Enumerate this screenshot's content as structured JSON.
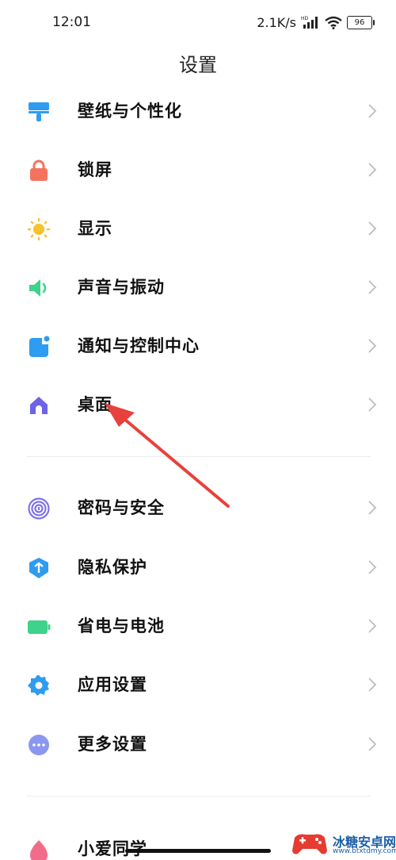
{
  "status_bar": {
    "time": "12:01",
    "net_speed": "2.1K/s",
    "battery": "96",
    "icons": [
      "hd-signal-icon",
      "wifi-icon",
      "battery-icon"
    ]
  },
  "header": {
    "title": "设置"
  },
  "group1": [
    {
      "label": "壁纸与个性化",
      "icon": "wallpaper-icon",
      "color": "#2e9cf0"
    },
    {
      "label": "锁屏",
      "icon": "lock-icon",
      "color": "#f4735e"
    },
    {
      "label": "显示",
      "icon": "sun-icon",
      "color": "#f7c22a"
    },
    {
      "label": "声音与振动",
      "icon": "speaker-icon",
      "color": "#3ed38a"
    },
    {
      "label": "通知与控制中心",
      "icon": "notification-icon",
      "color": "#2e9cf0"
    },
    {
      "label": "桌面",
      "icon": "home-icon",
      "color": "#6c63e6"
    }
  ],
  "group2": [
    {
      "label": "密码与安全",
      "icon": "fingerprint-icon",
      "color": "#7f72e8"
    },
    {
      "label": "隐私保护",
      "icon": "privacy-shield-icon",
      "color": "#2e9cf0"
    },
    {
      "label": "省电与电池",
      "icon": "battery-saver-icon",
      "color": "#3ed38a"
    },
    {
      "label": "应用设置",
      "icon": "app-gear-icon",
      "color": "#2e9cf0"
    },
    {
      "label": "更多设置",
      "icon": "more-dots-icon",
      "color": "#8b96ee"
    }
  ],
  "group3": [
    {
      "label": "小爱同学",
      "icon": "xiaoai-icon",
      "color": "#f06c8a"
    }
  ],
  "annotation": {
    "color": "#e8413b"
  },
  "watermark": {
    "title": "冰糖安卓网",
    "url": "www.btxtdmy.com"
  }
}
